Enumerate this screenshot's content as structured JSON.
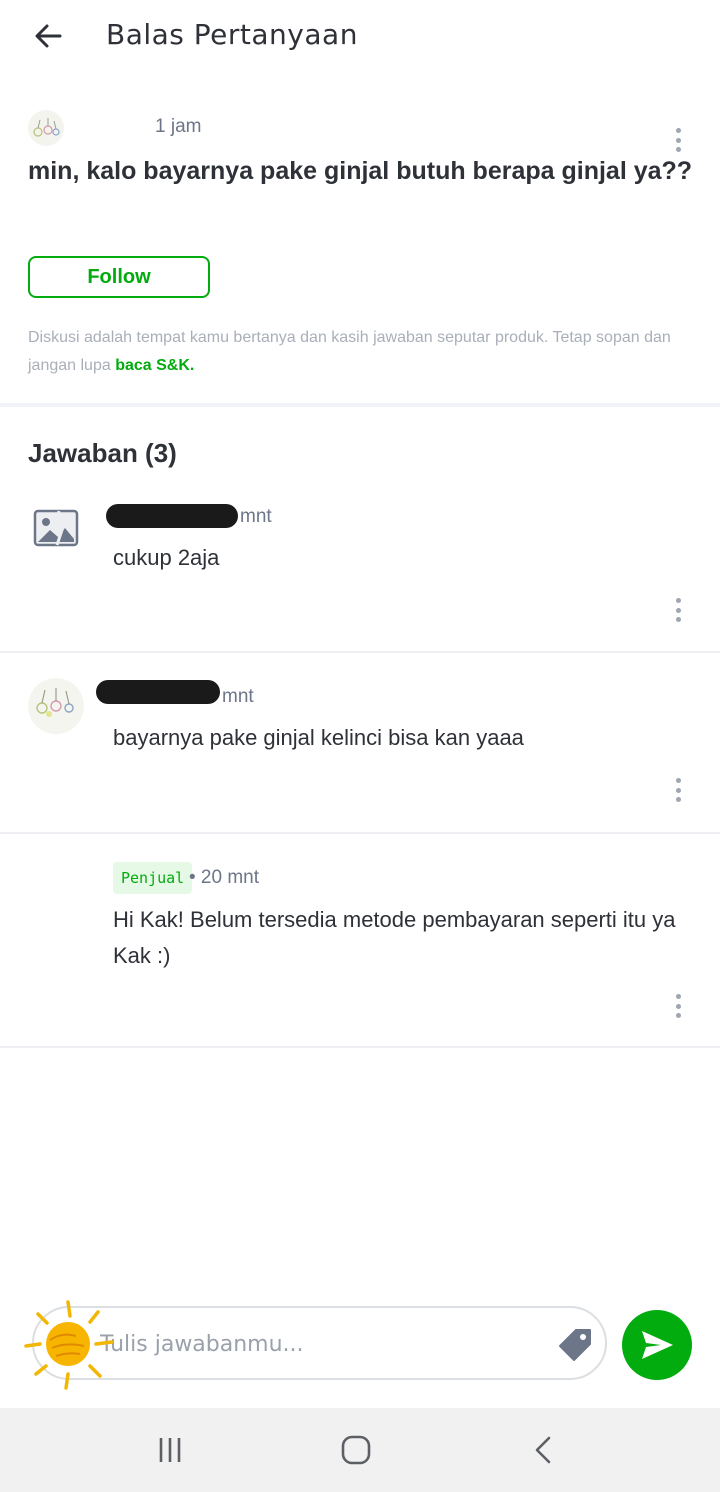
{
  "header": {
    "title": "Balas Pertanyaan"
  },
  "question": {
    "time": "1 jam",
    "text": "min, kalo bayarnya pake ginjal butuh berapa ginjal ya??",
    "follow_label": "Follow",
    "disclaimer_text": "Diskusi adalah tempat kamu bertanya dan kasih jawaban seputar produk. Tetap sopan dan jangan lupa ",
    "disclaimer_link": "baca S&K."
  },
  "answers": {
    "title": "Jawaban (3)",
    "items": [
      {
        "time": "mnt",
        "text": "cukup 2aja"
      },
      {
        "time": "mnt",
        "text": "bayarnya pake ginjal kelinci bisa kan yaaa"
      },
      {
        "badge": "Penjual",
        "time": "• 20 mnt",
        "text": "Hi Kak! Belum tersedia metode pembayaran seperti itu ya Kak :)"
      }
    ]
  },
  "compose": {
    "placeholder": "Tulis jawabanmu..."
  },
  "colors": {
    "accent": "#03ac0e",
    "text": "#2e3137",
    "muted": "#6d7588"
  },
  "icons": [
    "back-arrow-icon",
    "kebab-menu-icon",
    "image-placeholder-icon",
    "tag-icon",
    "send-icon",
    "recent-apps-icon",
    "home-icon",
    "back-nav-icon",
    "sun-sticker-icon"
  ]
}
